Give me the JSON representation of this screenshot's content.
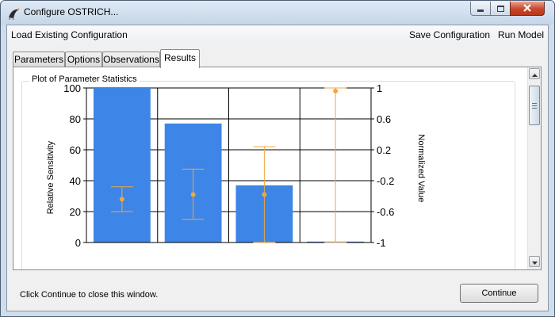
{
  "window": {
    "title": "Configure OSTRICH...",
    "icon": "ostrich-app-icon"
  },
  "menu": {
    "load": "Load Existing Configuration",
    "save": "Save Configuration",
    "run": "Run Model"
  },
  "tabs": [
    {
      "label": "Parameters",
      "selected": false
    },
    {
      "label": "Options",
      "selected": false
    },
    {
      "label": "Observations",
      "selected": false
    },
    {
      "label": "Results",
      "selected": true
    }
  ],
  "results": {
    "group_title": "Plot of Parameter Statistics"
  },
  "chart_data": {
    "type": "bar",
    "title": "",
    "left_axis": {
      "label": "Relative Sensitivity",
      "ylim": [
        0,
        100
      ],
      "ticks": [
        "0",
        "20",
        "40",
        "60",
        "80",
        "100"
      ]
    },
    "right_axis": {
      "label": "Normalized Value",
      "ylim": [
        -1,
        1
      ],
      "ticks": [
        "-1",
        "-0.6",
        "-0.2",
        "0.2",
        "0.6",
        "1"
      ]
    },
    "bars": [
      100,
      77,
      37,
      0.6
    ],
    "points": [
      {
        "value": -0.44,
        "low": -0.6,
        "high": -0.28
      },
      {
        "value": -0.38,
        "low": -0.7,
        "high": -0.05
      },
      {
        "value": -0.38,
        "low": -1.0,
        "high": 0.24
      },
      {
        "value": 0.96,
        "low": -1.0,
        "high": 1.0
      }
    ],
    "grid": true,
    "colors": {
      "bar": "#3d85e6",
      "point": "#f2a63c"
    }
  },
  "footer": {
    "status": "Click Continue to close this window.",
    "continue_label": "Continue"
  }
}
